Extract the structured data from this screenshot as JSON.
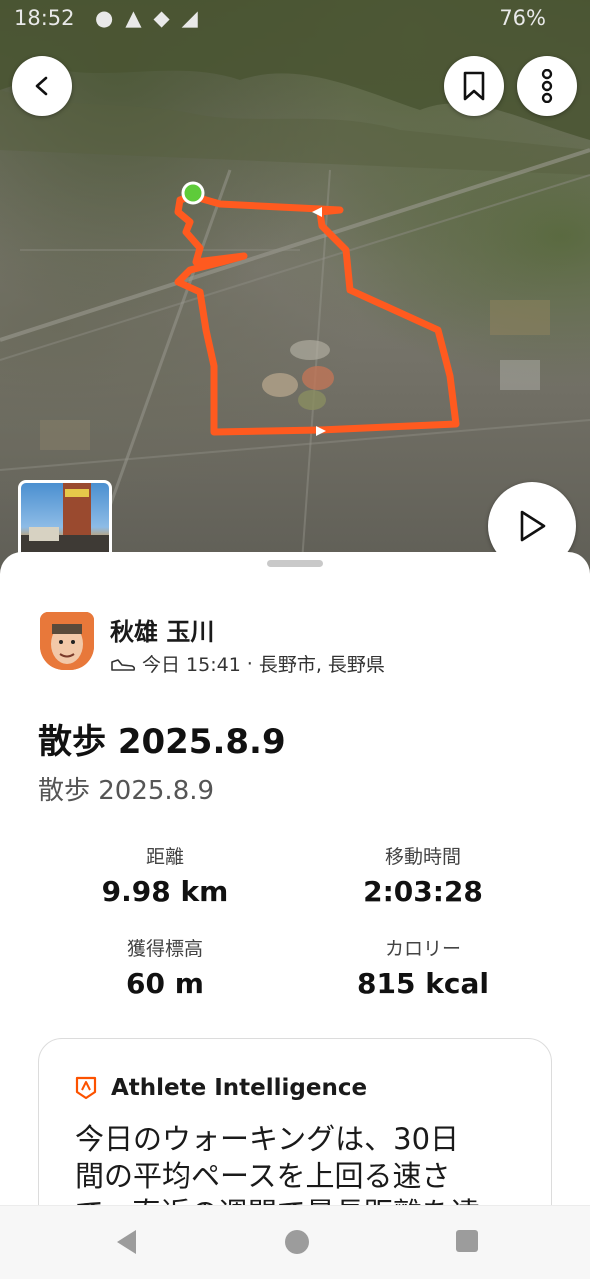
{
  "status_bar": {
    "time": "18:52",
    "battery": "76%",
    "icons": [
      "notification-icon",
      "warning-icon",
      "wifi-icon",
      "signal-icon",
      "battery-icon"
    ]
  },
  "map": {
    "route_color": "#ff5a1f",
    "start_color": "#5ecb3a"
  },
  "user": {
    "name": "秋雄 玉川",
    "time": "今日 15:41",
    "location": "長野市, 長野県"
  },
  "activity": {
    "title": "散歩 2025.8.9",
    "description": "散歩 2025.8.9"
  },
  "stats": {
    "distance": {
      "label": "距離",
      "value": "9.98 km"
    },
    "moving_time": {
      "label": "移動時間",
      "value": "2:03:28"
    },
    "elevation": {
      "label": "獲得標高",
      "value": "60 m"
    },
    "calories": {
      "label": "カロリー",
      "value": "815 kcal"
    }
  },
  "athlete_intelligence": {
    "title": "Athlete Intelligence",
    "line1": "今日のウォーキングは、30日",
    "line2": "間の平均ペースを上回る速さ",
    "line3": "で、直近の週間で最長距離を達"
  },
  "colors": {
    "accent": "#fc5200"
  }
}
